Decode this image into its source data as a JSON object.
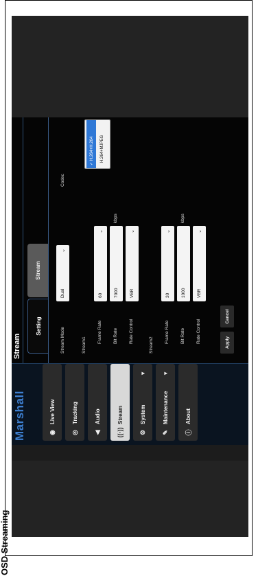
{
  "page_label": "OSD Streaming",
  "brand": "Marshall",
  "sidebar": {
    "items": [
      {
        "label": "Live View",
        "icon": "eye-icon"
      },
      {
        "label": "Tracking",
        "icon": "tracking-icon"
      },
      {
        "label": "Audio",
        "icon": "speaker-icon"
      },
      {
        "label": "Stream",
        "icon": "broadcast-icon",
        "active": true
      },
      {
        "label": "System",
        "icon": "gear-icon",
        "caret": "▼"
      },
      {
        "label": "Maintenance",
        "icon": "wrench-icon",
        "caret": "▼"
      },
      {
        "label": "About",
        "icon": "info-icon"
      }
    ]
  },
  "main": {
    "title": "Stream",
    "tabs": [
      {
        "label": "Setting"
      },
      {
        "label": "Stream"
      }
    ],
    "stream_mode": {
      "label": "Stream Mode",
      "value": "Dual"
    },
    "codec": {
      "label": "Codec",
      "options": [
        "✓ H.264+H.264",
        "H.264+MJPEG"
      ],
      "selected": "H.264+H.264"
    },
    "stream1": {
      "heading": "Stream1",
      "frame_rate": {
        "label": "Frame Rate",
        "value": "60"
      },
      "bit_rate": {
        "label": "Bit Rate",
        "value": "7000",
        "unit": "kbps"
      },
      "rate_control": {
        "label": "Rate Control",
        "value": "VBR"
      }
    },
    "stream2": {
      "heading": "Stream2",
      "frame_rate": {
        "label": "Frame Rate",
        "value": "30"
      },
      "bit_rate": {
        "label": "Bit Rate",
        "value": "1000",
        "unit": "kbps"
      },
      "rate_control": {
        "label": "Rate Control",
        "value": "VBR"
      }
    },
    "buttons": {
      "apply": "Apply",
      "cancel": "Cancel"
    }
  },
  "colors": {
    "brand": "#3d7fd0",
    "active_nav": "#d8d8d8",
    "selected_option": "#2f78d6"
  }
}
